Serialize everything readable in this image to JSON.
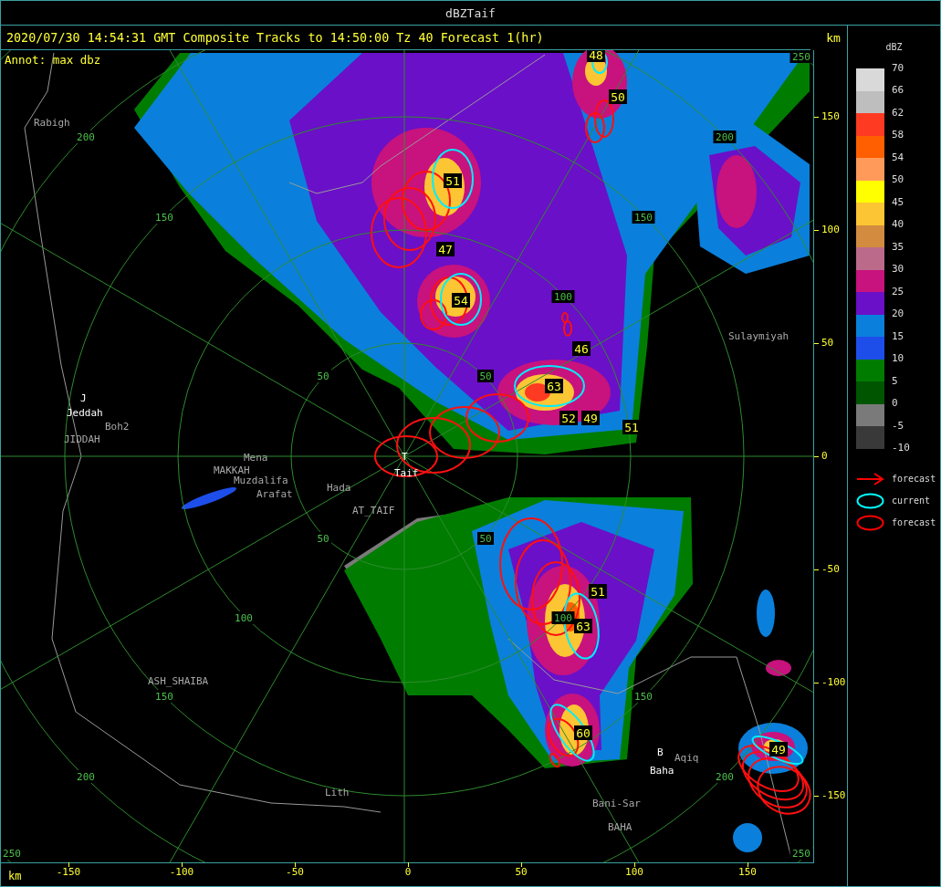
{
  "window": {
    "title": "dBZTaif"
  },
  "header": {
    "title": "2020/07/30 14:54:31 GMT Composite Tracks to 14:50:00 Tz 40 Forecast 1(hr)",
    "unit": "km"
  },
  "plot": {
    "annotation": "Annot: max dbz",
    "range_ring_labels": [
      "200",
      "150",
      "250",
      "200",
      "150",
      "100",
      "50",
      "50",
      "50",
      "100",
      "150",
      "200",
      "250",
      "50",
      "100",
      "150",
      "200",
      "250"
    ],
    "places": [
      {
        "label": "Rabigh",
        "kind": "minor"
      },
      {
        "label": "J",
        "kind": "major"
      },
      {
        "label": "Jeddah",
        "kind": "major"
      },
      {
        "label": "Boh2",
        "kind": "minor"
      },
      {
        "label": "JIDDAH",
        "kind": "minor"
      },
      {
        "label": "MAKKAH",
        "kind": "minor"
      },
      {
        "label": "Mena",
        "kind": "minor"
      },
      {
        "label": "Muzdalifa",
        "kind": "minor"
      },
      {
        "label": "Arafat",
        "kind": "minor"
      },
      {
        "label": "Hada",
        "kind": "minor"
      },
      {
        "label": "AT_TAIF",
        "kind": "minor"
      },
      {
        "label": "T",
        "kind": "major"
      },
      {
        "label": "Taif",
        "kind": "major"
      },
      {
        "label": "Sulaymiyah",
        "kind": "minor"
      },
      {
        "label": "ASH_SHAIBA",
        "kind": "minor"
      },
      {
        "label": "Lith",
        "kind": "minor"
      },
      {
        "label": "B",
        "kind": "major"
      },
      {
        "label": "Aqiq",
        "kind": "minor"
      },
      {
        "label": "Baha",
        "kind": "major"
      },
      {
        "label": "Bani-Sar",
        "kind": "minor"
      },
      {
        "label": "BAHA",
        "kind": "minor"
      }
    ],
    "cell_values": [
      "48",
      "50",
      "51",
      "47",
      "54",
      "46",
      "63",
      "52",
      "49",
      "51",
      "51",
      "63",
      "60",
      "49"
    ]
  },
  "x_axis": {
    "unit": "km",
    "ticks": [
      "-150",
      "-100",
      "-50",
      "0",
      "50",
      "100",
      "150"
    ]
  },
  "y_axis": {
    "ticks": [
      "150",
      "100",
      "50",
      "0",
      "-50",
      "-100",
      "-150"
    ]
  },
  "legend": {
    "title": "dBZ",
    "bins": [
      {
        "color": "#d9d9d9"
      },
      {
        "color": "#bebebe"
      },
      {
        "color": "#ff3a22"
      },
      {
        "color": "#ff5f00"
      },
      {
        "color": "#ff9a5a"
      },
      {
        "color": "#ffff00"
      },
      {
        "color": "#fcc533"
      },
      {
        "color": "#d38b3f"
      },
      {
        "color": "#bb6a8a"
      },
      {
        "color": "#c8127e"
      },
      {
        "color": "#6a10c8"
      },
      {
        "color": "#0a80dc"
      },
      {
        "color": "#1e4eea"
      },
      {
        "color": "#007d00"
      },
      {
        "color": "#005500"
      },
      {
        "color": "#7a7a7a"
      },
      {
        "color": "#393939"
      }
    ],
    "labels": [
      "70",
      "66",
      "62",
      "58",
      "54",
      "50",
      "45",
      "40",
      "35",
      "30",
      "25",
      "20",
      "15",
      "10",
      "5",
      "0",
      "-5",
      "-10"
    ],
    "symbols": [
      {
        "kind": "arrow",
        "color": "#ff0000",
        "label": "forecast"
      },
      {
        "kind": "ellipse",
        "color": "#00ffff",
        "label": "current"
      },
      {
        "kind": "ellipse",
        "color": "#ff0000",
        "label": "forecast"
      }
    ]
  }
}
